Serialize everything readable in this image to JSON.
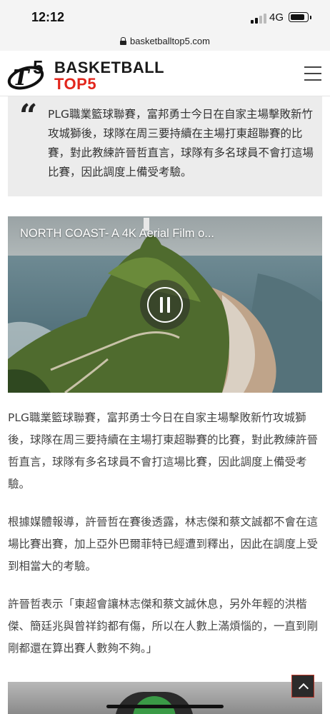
{
  "status_bar": {
    "time": "12:12",
    "network": "4G"
  },
  "browser": {
    "url": "basketballtop5.com"
  },
  "site": {
    "logo_line1": "BASKETBALL",
    "logo_line2": "TOP5",
    "accent_color": "#e2261c"
  },
  "quote": {
    "text": "PLG職業籃球聯賽，富邦勇士今日在自家主場擊敗新竹攻城獅後，球隊在周三要持續在主場打東超聯賽的比賽，對此教練許晉哲直言，球隊有多名球員不會打這場比賽，因此調度上備受考驗。"
  },
  "video": {
    "title": "NORTH COAST- A 4K Aerial Film o...",
    "state_icon": "pause-icon"
  },
  "article": {
    "paragraphs": [
      "PLG職業籃球聯賽，富邦勇士今日在自家主場擊敗新竹攻城獅後，球隊在周三要持續在主場打東超聯賽的比賽，對此教練許晉哲直言，球隊有多名球員不會打這場比賽，因此調度上備受考驗。",
      "根據媒體報導，許晉哲在賽後透露，林志傑和蔡文誠都不會在這場比賽出賽，加上亞外巴爾菲特已經遭到釋出，因此在調度上受到相當大的考驗。",
      "許晉哲表示「東超會讓林志傑和蔡文誠休息，另外年輕的洪楷傑、簡廷兆與曾祥鈞都有傷，所以在人數上滿煩惱的，一直到剛剛都還在算出賽人數夠不夠。」"
    ]
  }
}
